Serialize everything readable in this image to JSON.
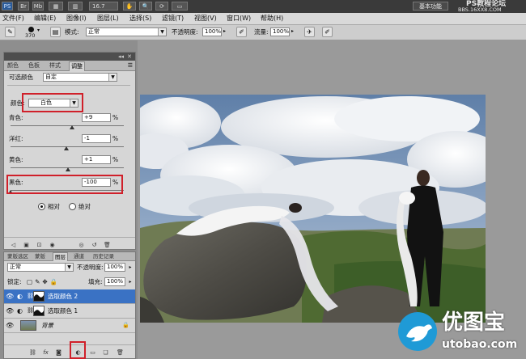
{
  "titlebar": {
    "app_icon": "PS",
    "br": "Br",
    "mb": "Mb",
    "zoom": "16.7",
    "workspace": "基本功能",
    "watermark_line1": "PS教程论坛",
    "watermark_line2": "BBS.16XX8.COM"
  },
  "menu": [
    "文件(F)",
    "编辑(E)",
    "图像(I)",
    "图层(L)",
    "选择(S)",
    "滤镜(T)",
    "视图(V)",
    "窗口(W)",
    "帮助(H)"
  ],
  "options": {
    "brush_size": "370",
    "mode_label": "模式:",
    "mode_value": "正常",
    "opacity_label": "不透明度:",
    "opacity_value": "100%",
    "flow_label": "流量:",
    "flow_value": "100%"
  },
  "adjustments": {
    "tabs": [
      "颜色",
      "色板",
      "样式",
      "调整"
    ],
    "active_tab": 3,
    "title": "可选颜色",
    "preset_value": "自定",
    "color_label": "颜色:",
    "color_value": "白色",
    "sliders": [
      {
        "label": "青色:",
        "value": "+9",
        "unit": "%",
        "level": 0.545
      },
      {
        "label": "洋红:",
        "value": "-1",
        "unit": "%",
        "level": 0.495
      },
      {
        "label": "黄色:",
        "value": "+1",
        "unit": "%",
        "level": 0.505
      },
      {
        "label": "黑色:",
        "value": "-100",
        "unit": "%",
        "level": 0.0
      }
    ],
    "radio_relative": "相对",
    "radio_absolute": "绝对",
    "selected_radio": "相对"
  },
  "layers": {
    "tabs": [
      "蒙版选区",
      "蒙版",
      "图层",
      "通道",
      "历史记录"
    ],
    "active_tab": 2,
    "blend_mode": "正常",
    "opacity_label": "不透明度:",
    "opacity_value": "100%",
    "lock_label": "锁定:",
    "fill_label": "填充:",
    "fill_value": "100%",
    "rows": [
      {
        "name": "选取颜色 2",
        "selected": true
      },
      {
        "name": "选取颜色 1",
        "selected": false
      },
      {
        "name": "背景",
        "selected": false
      }
    ]
  },
  "logo": {
    "brand": "优图宝",
    "url": "utobao.com"
  },
  "colors": {
    "highlight": "#d0202a",
    "selection": "#3a72c4"
  }
}
